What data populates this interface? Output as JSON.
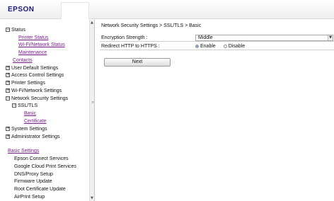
{
  "header": {
    "logo": "EPSON"
  },
  "sidebar": {
    "items": [
      {
        "label": "Status",
        "expander": "−",
        "type": "group"
      },
      {
        "label": "Printer Status",
        "type": "link"
      },
      {
        "label": "Wi-Fi/Network Status",
        "type": "link"
      },
      {
        "label": "Maintenance",
        "type": "link"
      },
      {
        "label": "Contacts",
        "type": "link"
      },
      {
        "label": "User Default Settings",
        "expander": "+",
        "type": "group"
      },
      {
        "label": "Access Control Settings",
        "expander": "+",
        "type": "group"
      },
      {
        "label": "Printer Settings",
        "expander": "+",
        "type": "group"
      },
      {
        "label": "Wi-Fi/Network Settings",
        "expander": "+",
        "type": "group"
      },
      {
        "label": "Network Security Settings",
        "expander": "−",
        "type": "group"
      },
      {
        "label": "SSL/TLS",
        "expander": "−",
        "type": "subgroup"
      },
      {
        "label": "Basic",
        "type": "link"
      },
      {
        "label": "Certificate",
        "type": "link"
      },
      {
        "label": "System Settings",
        "expander": "+",
        "type": "group"
      },
      {
        "label": "Administrator Settings",
        "expander": "+",
        "type": "group"
      },
      {
        "label": "Basic Settings",
        "type": "link"
      },
      {
        "label": "Epson Connect Services",
        "type": "item"
      },
      {
        "label": "Google Cloud Print Services",
        "type": "item"
      },
      {
        "label": "DNS/Proxy Setup",
        "type": "item"
      },
      {
        "label": "Firmware Update",
        "type": "item"
      },
      {
        "label": "Root Certificate Update",
        "type": "item"
      },
      {
        "label": "AirPrint Setup",
        "type": "item"
      }
    ]
  },
  "main": {
    "breadcrumb": "Network Security Settings > SSL/TLS > Basic",
    "encryption": {
      "label": "Encryption Strength :",
      "value": "Middle"
    },
    "redirect": {
      "label": "Redirect HTTP to HTTPS :",
      "options": [
        {
          "label": "Enable",
          "selected": true
        },
        {
          "label": "Disable",
          "selected": false
        }
      ]
    },
    "next_label": "Next"
  },
  "colors": {
    "link": "#7a1d8c",
    "logo": "#1a1a7a",
    "radio_selected": "#1e5bb4"
  }
}
